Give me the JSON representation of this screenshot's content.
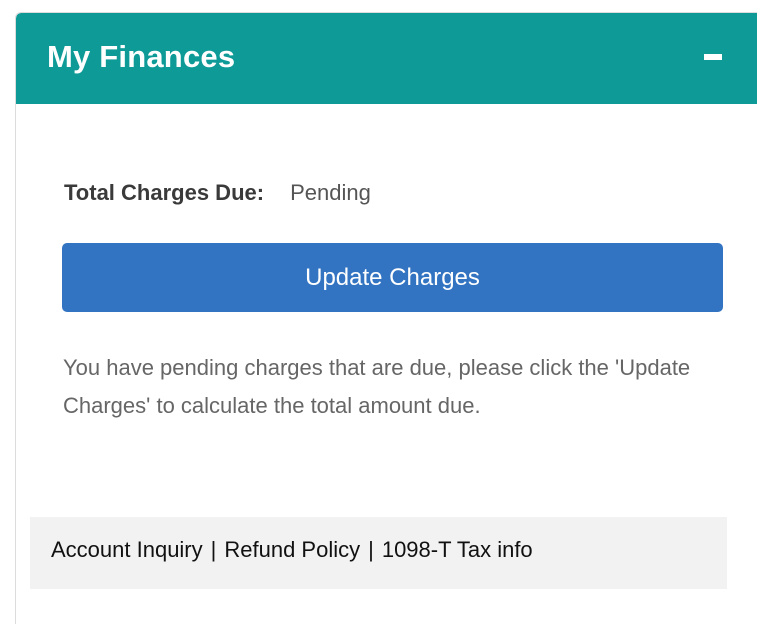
{
  "widget": {
    "title": "My Finances",
    "collapse_label": "−",
    "charges": {
      "label": "Total Charges Due:",
      "value": "Pending"
    },
    "update_button_label": "Update Charges",
    "message": "You have pending charges that are due, please click the 'Update Charges' to calculate the total amount due.",
    "footer": {
      "links": [
        "Account Inquiry",
        "Refund Policy",
        "1098-T Tax info"
      ],
      "separator": "|"
    }
  },
  "colors": {
    "header_bg": "#0e9b98",
    "button_bg": "#3274c2",
    "footer_bg": "#f2f2f2"
  }
}
